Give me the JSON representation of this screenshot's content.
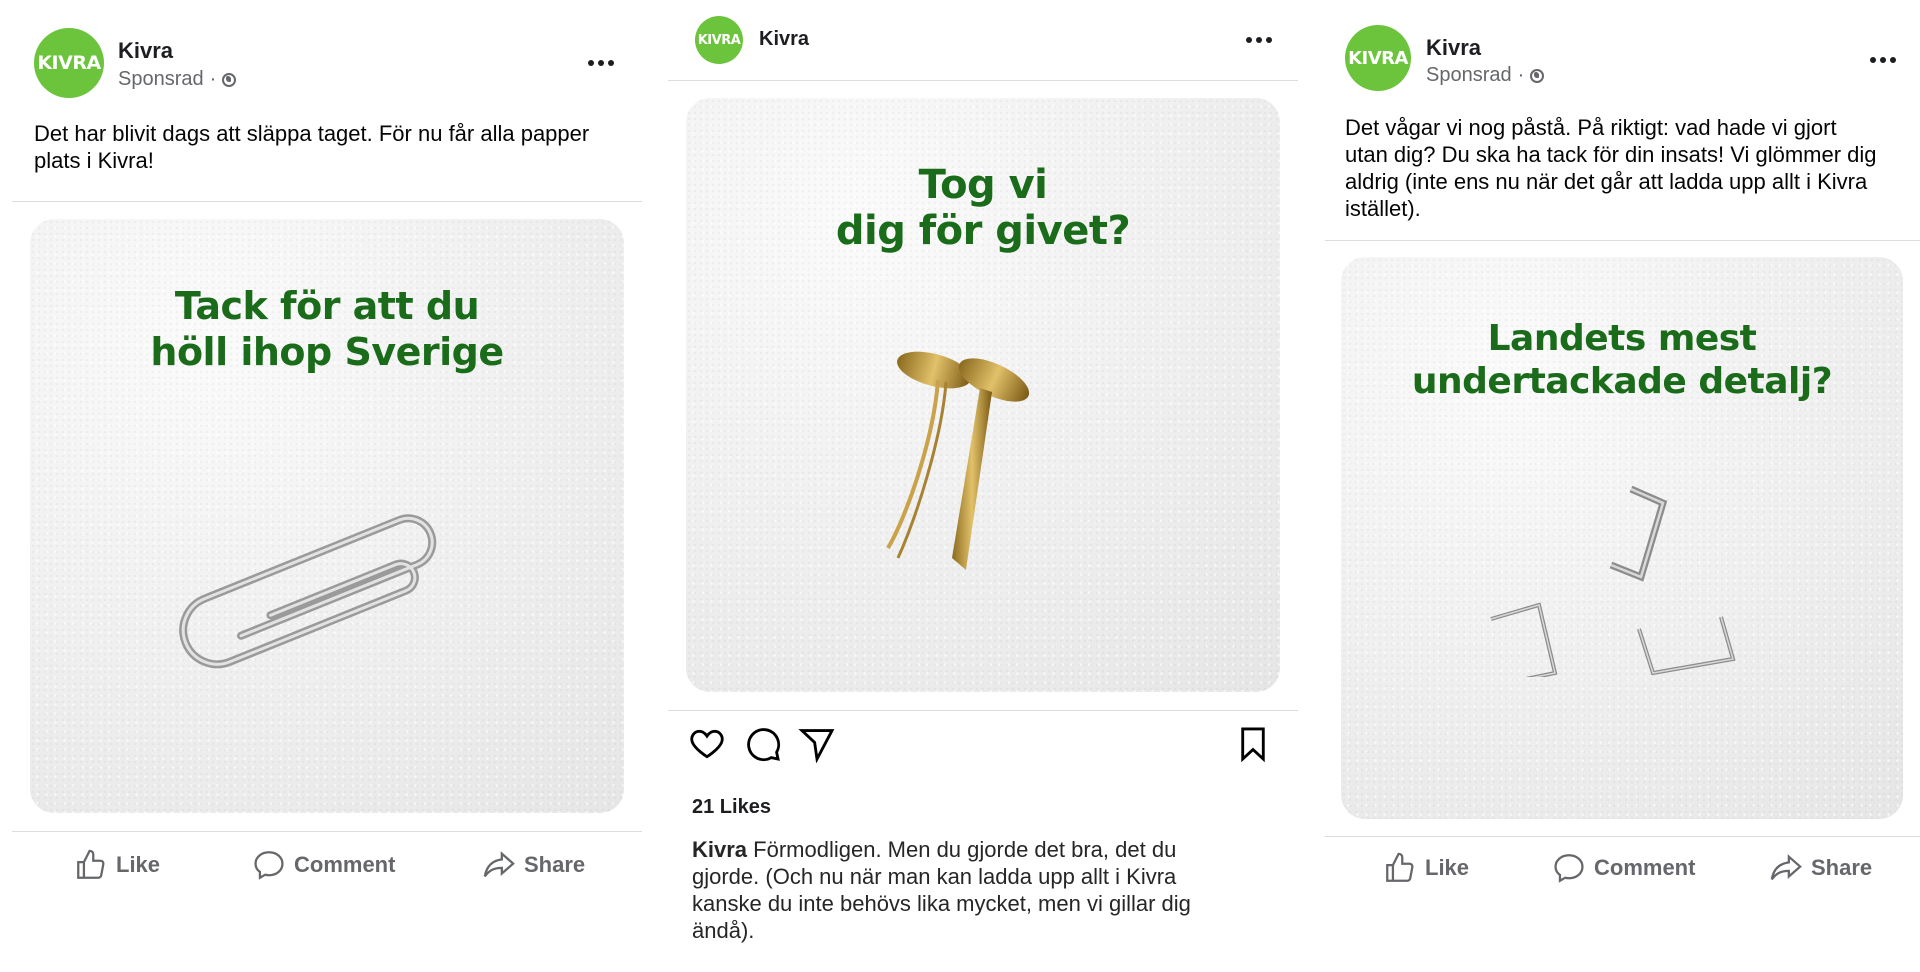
{
  "posts": {
    "fb1": {
      "brand": "Kivra",
      "logo_text": "KIVRA",
      "sponsored": "Sponsrad",
      "separator": "·",
      "caption": "Det har blivit dags att släppa taget. För nu får alla papper plats i Kivra!",
      "ad_title_line1": "Tack för att du",
      "ad_title_line2": "höll ihop Sverige",
      "actions": {
        "like": "Like",
        "comment": "Comment",
        "share": "Share"
      }
    },
    "ig": {
      "brand": "Kivra",
      "logo_text": "KIVRA",
      "ad_title_line1": "Tog vi",
      "ad_title_line2": "dig för givet?",
      "likes": "21 Likes",
      "caption_user": "Kivra",
      "caption_text": " Förmodligen. Men du gjorde det bra, det du gjorde. (Och nu när man kan ladda upp allt i Kivra kanske du inte behövs lika mycket, men vi gillar dig ändå)."
    },
    "fb2": {
      "brand": "Kivra",
      "logo_text": "KIVRA",
      "sponsored": "Sponsrad",
      "separator": "·",
      "caption": "Det vågar vi nog påstå. På riktigt: vad hade vi gjort utan dig? Du ska ha tack för din insats! Vi glömmer dig aldrig (inte ens nu när det går att ladda upp allt i Kivra istället).",
      "ad_title_line1": "Landets mest",
      "ad_title_line2": "undertackade detalj?",
      "actions": {
        "like": "Like",
        "comment": "Comment",
        "share": "Share"
      }
    }
  },
  "colors": {
    "brand_green": "#6bc43b",
    "ad_text_green": "#1a6b1a",
    "muted_text": "#65676b"
  },
  "icons": [
    "globe-icon",
    "more-icon",
    "like-icon",
    "comment-icon",
    "share-icon",
    "heart-icon",
    "ig-comment-icon",
    "send-icon",
    "bookmark-icon",
    "paperclip",
    "brass-fastener",
    "staples"
  ]
}
